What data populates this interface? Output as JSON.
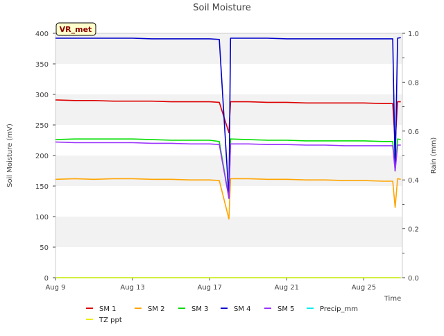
{
  "chart_data": {
    "type": "line",
    "title": "Soil Moisture",
    "xlabel": "Time",
    "ylabel": "Soil Moisture (mV)",
    "y2label": "Rain (mm)",
    "site_badge": "VR_met",
    "x_start": "2023-08-09",
    "x_end": "2023-08-27",
    "x_ticks": [
      {
        "label": "Aug 9",
        "date": "2023-08-09"
      },
      {
        "label": "Aug 13",
        "date": "2023-08-13"
      },
      {
        "label": "Aug 17",
        "date": "2023-08-17"
      },
      {
        "label": "Aug 21",
        "date": "2023-08-21"
      },
      {
        "label": "Aug 25",
        "date": "2023-08-25"
      }
    ],
    "ylim": [
      0,
      400
    ],
    "y_ticks": [
      "0",
      "50",
      "100",
      "150",
      "200",
      "250",
      "300",
      "350",
      "400"
    ],
    "y2lim": [
      0,
      1.0
    ],
    "y2_ticks": [
      "0.0",
      "0.2",
      "0.4",
      "0.6",
      "0.8",
      "1.0"
    ],
    "grid": "horizontal bands",
    "legend_position": "bottom",
    "series": [
      {
        "name": "SM 1",
        "color": "#dd0000",
        "axis": "left",
        "x": [
          "2023-08-09",
          "2023-08-10",
          "2023-08-11",
          "2023-08-12",
          "2023-08-13",
          "2023-08-14",
          "2023-08-15",
          "2023-08-16",
          "2023-08-17",
          "2023-08-17 12:00",
          "2023-08-18 00:00",
          "2023-08-18 02:00",
          "2023-08-19",
          "2023-08-20",
          "2023-08-21",
          "2023-08-22",
          "2023-08-23",
          "2023-08-24",
          "2023-08-25",
          "2023-08-26",
          "2023-08-26 12:00",
          "2023-08-26 15:00",
          "2023-08-26 18:00",
          "2023-08-26 22:00"
        ],
        "y": [
          291,
          290,
          290,
          289,
          289,
          289,
          288,
          288,
          288,
          287,
          237,
          288,
          288,
          287,
          287,
          286,
          286,
          286,
          286,
          285,
          285,
          220,
          288,
          288
        ]
      },
      {
        "name": "SM 2",
        "color": "#ffa500",
        "axis": "left",
        "x": [
          "2023-08-09",
          "2023-08-10",
          "2023-08-11",
          "2023-08-12",
          "2023-08-13",
          "2023-08-14",
          "2023-08-15",
          "2023-08-16",
          "2023-08-17",
          "2023-08-17 12:00",
          "2023-08-18 00:00",
          "2023-08-18 02:00",
          "2023-08-19",
          "2023-08-20",
          "2023-08-21",
          "2023-08-22",
          "2023-08-23",
          "2023-08-24",
          "2023-08-25",
          "2023-08-26",
          "2023-08-26 12:00",
          "2023-08-26 15:00",
          "2023-08-26 18:00",
          "2023-08-26 22:00"
        ],
        "y": [
          161,
          162,
          161,
          162,
          162,
          161,
          161,
          160,
          160,
          159,
          96,
          162,
          162,
          161,
          161,
          160,
          160,
          159,
          159,
          158,
          158,
          115,
          162,
          161
        ]
      },
      {
        "name": "SM 3",
        "color": "#00dd00",
        "axis": "left",
        "x": [
          "2023-08-09",
          "2023-08-10",
          "2023-08-11",
          "2023-08-12",
          "2023-08-13",
          "2023-08-14",
          "2023-08-15",
          "2023-08-16",
          "2023-08-17",
          "2023-08-17 12:00",
          "2023-08-18 00:00",
          "2023-08-18 02:00",
          "2023-08-19",
          "2023-08-20",
          "2023-08-21",
          "2023-08-22",
          "2023-08-23",
          "2023-08-24",
          "2023-08-25",
          "2023-08-26",
          "2023-08-26 12:00",
          "2023-08-26 15:00",
          "2023-08-26 18:00",
          "2023-08-26 22:00"
        ],
        "y": [
          226,
          227,
          227,
          227,
          227,
          226,
          225,
          225,
          225,
          223,
          130,
          227,
          226,
          225,
          225,
          224,
          224,
          224,
          224,
          223,
          223,
          175,
          227,
          226
        ]
      },
      {
        "name": "SM 4",
        "color": "#0000cc",
        "axis": "left",
        "x": [
          "2023-08-09",
          "2023-08-10",
          "2023-08-11",
          "2023-08-12",
          "2023-08-13",
          "2023-08-14",
          "2023-08-15",
          "2023-08-16",
          "2023-08-17",
          "2023-08-17 12:00",
          "2023-08-18 00:00",
          "2023-08-18 02:00",
          "2023-08-19",
          "2023-08-20",
          "2023-08-21",
          "2023-08-22",
          "2023-08-23",
          "2023-08-24",
          "2023-08-25",
          "2023-08-26",
          "2023-08-26 12:00",
          "2023-08-26 15:00",
          "2023-08-26 18:00",
          "2023-08-26 22:00"
        ],
        "y": [
          392,
          392,
          392,
          392,
          392,
          391,
          391,
          391,
          391,
          390,
          130,
          392,
          392,
          392,
          391,
          391,
          391,
          391,
          391,
          391,
          391,
          175,
          392,
          393
        ]
      },
      {
        "name": "SM 5",
        "color": "#9933ff",
        "axis": "left",
        "x": [
          "2023-08-09",
          "2023-08-10",
          "2023-08-11",
          "2023-08-12",
          "2023-08-13",
          "2023-08-14",
          "2023-08-15",
          "2023-08-16",
          "2023-08-17",
          "2023-08-17 12:00",
          "2023-08-18 00:00",
          "2023-08-18 02:00",
          "2023-08-19",
          "2023-08-20",
          "2023-08-21",
          "2023-08-22",
          "2023-08-23",
          "2023-08-24",
          "2023-08-25",
          "2023-08-26",
          "2023-08-26 12:00",
          "2023-08-26 15:00",
          "2023-08-26 18:00",
          "2023-08-26 22:00"
        ],
        "y": [
          222,
          221,
          221,
          221,
          221,
          220,
          220,
          219,
          219,
          218,
          130,
          219,
          219,
          218,
          218,
          217,
          217,
          216,
          216,
          216,
          216,
          175,
          217,
          217
        ]
      },
      {
        "name": "Precip_mm",
        "color": "#00eeee",
        "axis": "right",
        "x": [
          "2023-08-09",
          "2023-08-26 22:00"
        ],
        "y": [
          0,
          0
        ]
      },
      {
        "name": "TZ ppt",
        "color": "#eeee00",
        "axis": "left",
        "x": [
          "2023-08-09",
          "2023-08-26 22:00"
        ],
        "y": [
          0,
          0
        ]
      }
    ]
  }
}
